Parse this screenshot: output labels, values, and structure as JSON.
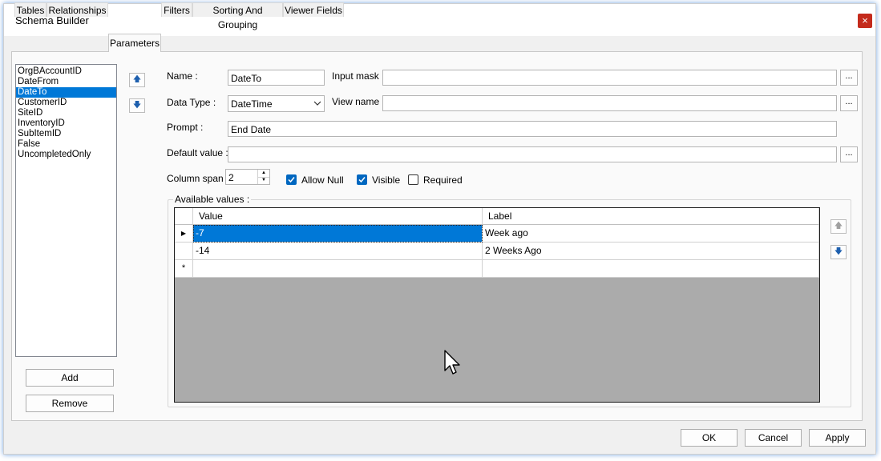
{
  "window": {
    "title": "Schema Builder",
    "close_glyph": "×"
  },
  "tabs": [
    {
      "label": "Tables"
    },
    {
      "label": "Relationships"
    },
    {
      "label": "Parameters"
    },
    {
      "label": "Filters"
    },
    {
      "label": "Sorting And Grouping"
    },
    {
      "label": "Viewer Fields"
    }
  ],
  "active_tab": "Parameters",
  "parameters": {
    "items": [
      "OrgBAccountID",
      "DateFrom",
      "DateTo",
      "CustomerID",
      "SiteID",
      "InventoryID",
      "SubItemID",
      "False",
      "UncompletedOnly"
    ],
    "selected": "DateTo",
    "add_label": "Add",
    "remove_label": "Remove"
  },
  "form": {
    "name_label": "Name :",
    "name_value": "DateTo",
    "input_mask_label": "Input mask :",
    "input_mask_value": "",
    "data_type_label": "Data Type :",
    "data_type_value": "DateTime",
    "view_name_label": "View name :",
    "view_name_value": "",
    "prompt_label": "Prompt :",
    "prompt_value": "End Date",
    "default_value_label": "Default value :",
    "default_value_value": "",
    "column_span_label": "Column span :",
    "column_span_value": "2",
    "ellipsis": "...",
    "allow_null_label": "Allow Null",
    "allow_null": true,
    "visible_label": "Visible",
    "visible": true,
    "required_label": "Required",
    "required": false
  },
  "available_values": {
    "label": "Available values :",
    "columns": [
      "Value",
      "Label"
    ],
    "rows": [
      {
        "value": "-7",
        "label": "Week ago"
      },
      {
        "value": "-14",
        "label": "2 Weeks Ago"
      }
    ],
    "new_row_glyph": "*"
  },
  "footer": {
    "ok_label": "OK",
    "cancel_label": "Cancel",
    "apply_label": "Apply"
  },
  "colors": {
    "accent": "#0078d7",
    "close": "#c42b1c",
    "grid_empty": "#ababab"
  }
}
